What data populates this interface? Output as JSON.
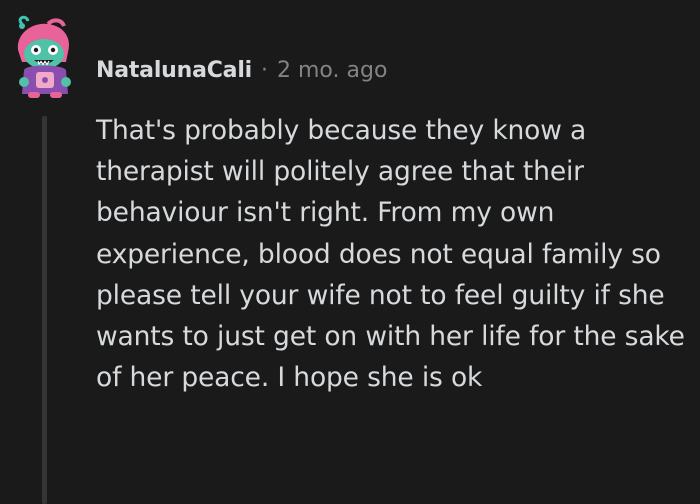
{
  "comment": {
    "username": "NatalunaCali",
    "separator": "·",
    "timestamp": "2 mo. ago",
    "body": "That's probably because they know a therapist will politely agree that their behaviour isn't right. From my own experience, blood does not equal family so please tell your wife not to feel guilty if she wants to just get on with her life for the sake of her peace. I hope she is ok",
    "avatar_icon": "avatar-icon"
  },
  "colors": {
    "background": "#1a1a1b",
    "text_primary": "#d7dadc",
    "text_muted": "#818384",
    "thread_line": "#343536"
  }
}
